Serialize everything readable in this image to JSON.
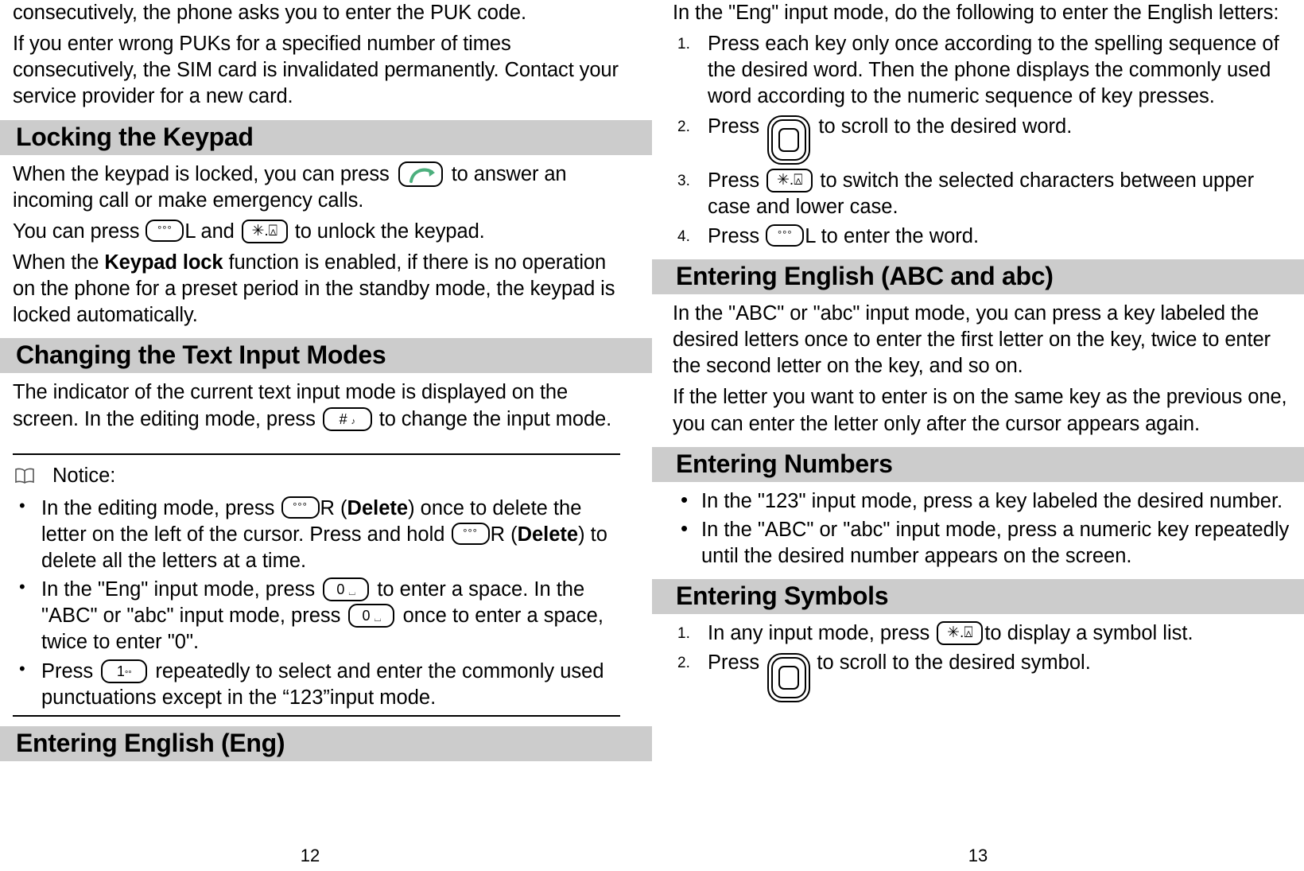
{
  "document": {
    "type": "mobile-phone-user-manual",
    "left_page_number": "12",
    "right_page_number": "13"
  },
  "left_column": {
    "continued_paragraph": "consecutively, the phone asks you to enter the PUK code.",
    "paragraph_puk": "If you enter wrong PUKs for a specified number of times consecutively, the SIM card is invalidated permanently. Contact your service provider for a new card.",
    "heading_locking_keypad": "Locking the Keypad",
    "locked_text_1a": "When the keypad is locked, you can press",
    "locked_text_1b": "to answer an incoming call or make emergency calls.",
    "unlock_text_a": "You can press",
    "unlock_text_b": "L and",
    "unlock_text_c": "to unlock the keypad.",
    "keypad_lock_a": "When the ",
    "keypad_lock_bold": "Keypad lock",
    "keypad_lock_b": " function is enabled, if there is no operation on the phone for a preset period in the standby mode, the keypad is locked automatically.",
    "heading_changing_modes": "Changing the Text Input Modes",
    "indicator_text_a": "The indicator of the current text input mode is displayed on the screen. In the editing mode, press",
    "indicator_text_b": "to change the input mode.",
    "notice_label": "Notice:",
    "notice_icon": "book-icon",
    "notice_items": [
      {
        "a": "In the editing mode, press",
        "b": "R (",
        "bold1": "Delete",
        "c": ") once to delete the letter on the left of the cursor. Press and hold",
        "d": "R (",
        "bold2": "Delete",
        "e": ") to delete all the letters at a time."
      },
      {
        "a": "In the \"Eng\" input mode, press",
        "b": "to enter a space. In the \"ABC\" or \"abc\" input mode, press",
        "c": "once to enter a space, twice to enter \"0\"."
      },
      {
        "a": "Press",
        "b": "repeatedly to select and enter the commonly used punctuations except in the “123”input mode."
      }
    ],
    "heading_entering_english_eng": "Entering English (Eng)"
  },
  "right_column": {
    "eng_intro": "In the \"Eng\" input mode, do the following to enter the English letters:",
    "steps_eng": [
      {
        "num": "1.",
        "text": "Press each key only once according to the spelling sequence of the desired word. Then the phone displays the commonly used word according to the numeric sequence of key presses."
      },
      {
        "num": "2.",
        "a": "Press",
        "b": "to scroll to the desired word."
      },
      {
        "num": "3.",
        "a": "Press",
        "b": "to switch the selected characters between upper case and lower case."
      },
      {
        "num": "4.",
        "a": "Press",
        "b": "L to enter the word."
      }
    ],
    "heading_entering_abc": "Entering English (ABC and abc)",
    "abc_paragraph_1": "In the \"ABC\" or \"abc\" input mode, you can press a key labeled the desired letters once to enter the first letter on the key, twice to enter the second letter on the key, and so on.",
    "abc_paragraph_2": "If the letter you want to enter is on the same key as the previous one, you can enter the letter only after the cursor appears again.",
    "heading_entering_numbers": "Entering Numbers",
    "numbers_items": [
      "In the \"123\" input mode, press a key labeled the desired number.",
      "In the \"ABC\" or \"abc\" input mode, press a numeric key repeatedly until the desired number appears on the screen."
    ],
    "heading_entering_symbols": "Entering Symbols",
    "symbols_steps": [
      {
        "num": "1.",
        "a": "In any input mode, press",
        "b": "to display a symbol list."
      },
      {
        "num": "2.",
        "a": "Press",
        "b": "to scroll to the desired symbol."
      }
    ]
  },
  "icons": {
    "softkey": {
      "name": "soft-key-icon",
      "glyph": "°°°"
    },
    "starkey": {
      "name": "star-lock-key-icon",
      "glyph": "✳.⍓"
    },
    "hashkey": {
      "name": "hash-silent-key-icon",
      "glyph": "#",
      "sub": "♪"
    },
    "zerokey": {
      "name": "zero-space-key-icon",
      "glyph": "0",
      "sub": "⌴"
    },
    "onekey": {
      "name": "one-punctuation-key-icon",
      "glyph": "1",
      "sub": "°°"
    },
    "callkey": {
      "name": "answer-call-key-icon",
      "color": "#4caf7d"
    },
    "navkey": {
      "name": "navigation-scroll-key-icon"
    },
    "book": {
      "name": "book-icon"
    }
  },
  "colors": {
    "heading_background": "#cccccc",
    "text": "#000000",
    "page_background": "#ffffff",
    "call_key_green": "#4caf7d"
  }
}
